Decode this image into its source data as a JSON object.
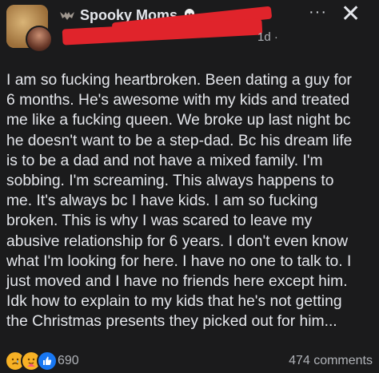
{
  "header": {
    "group_name": "Spooky Moms",
    "time": "1d ·",
    "more_label": "···",
    "close_label": "✕"
  },
  "post": {
    "lines": [
      "I am so fucking heartbroken. Been dating a guy for",
      "6 months. He's awesome with my kids and treated",
      "me like a fucking queen. We broke up last night bc",
      "he doesn't want to be a step-dad. Bc his dream life",
      "is to be a dad and not have a mixed family. I'm",
      "sobbing. I'm screaming. This always happens to",
      "me. It's always bc I have kids. I am so fucking",
      "broken. This is why I was scared to leave my",
      "abusive relationship for 6 years. I don't even know",
      "what I'm looking for here. I have no one to talk to. I",
      "just moved and I have no friends here except him.",
      "Idk how to explain to my kids that he's not getting",
      "the Christmas presents they picked out for him..."
    ]
  },
  "footer": {
    "reaction_icons": [
      "sad-reaction-icon",
      "care-reaction-icon",
      "like-reaction-icon"
    ],
    "reaction_count": "690",
    "comments": "474 comments"
  },
  "colors": {
    "background": "#1b1b1c",
    "text": "#e4e6eb",
    "muted": "#b0b3b8",
    "redaction": "#e0242b",
    "like_blue": "#1877f2"
  }
}
